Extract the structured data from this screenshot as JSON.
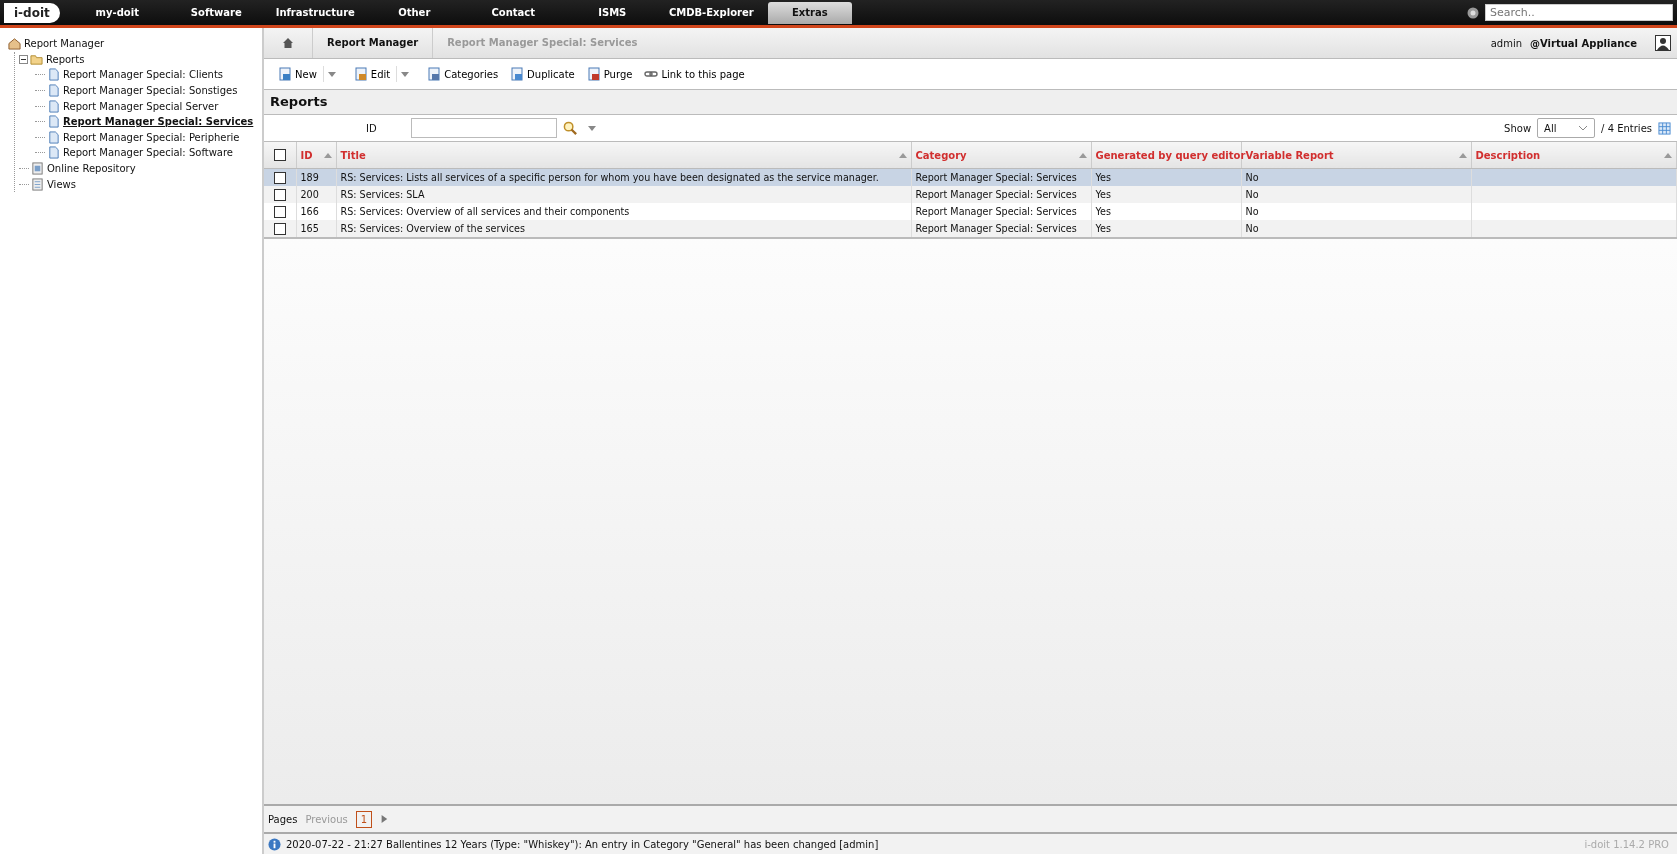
{
  "logo": "i-doit",
  "nav": [
    {
      "label": "my-doit",
      "selected": false
    },
    {
      "label": "Software",
      "selected": false
    },
    {
      "label": "Infrastructure",
      "selected": false
    },
    {
      "label": "Other",
      "selected": false
    },
    {
      "label": "Contact",
      "selected": false
    },
    {
      "label": "ISMS",
      "selected": false
    },
    {
      "label": "CMDB-Explorer",
      "selected": false
    },
    {
      "label": "Extras",
      "selected": true
    }
  ],
  "search": {
    "placeholder": "Search.."
  },
  "tree": [
    {
      "label": "Report Manager",
      "kind": "home",
      "children": [
        {
          "label": "Reports",
          "kind": "folder",
          "expanded": true,
          "children": [
            {
              "label": "Report Manager Special: Clients",
              "kind": "report",
              "selected": false
            },
            {
              "label": "Report Manager Special: Sonstiges",
              "kind": "report",
              "selected": false
            },
            {
              "label": "Report Manager Special Server",
              "kind": "report",
              "selected": false
            },
            {
              "label": "Report Manager Special: Services",
              "kind": "report",
              "selected": true
            },
            {
              "label": "Report Manager Special: Peripherie",
              "kind": "report",
              "selected": false
            },
            {
              "label": "Report Manager Special: Software",
              "kind": "report",
              "selected": false
            }
          ]
        },
        {
          "label": "Online Repository",
          "kind": "repo"
        },
        {
          "label": "Views",
          "kind": "views"
        }
      ]
    }
  ],
  "breadcrumb": [
    "Report Manager",
    "Report Manager Special: Services"
  ],
  "user": {
    "name": "admin",
    "tenant": "@Virtual Appliance"
  },
  "toolbar": [
    {
      "label": "New",
      "kind": "new",
      "menu": true
    },
    {
      "label": "Edit",
      "kind": "edit",
      "menu": true
    },
    {
      "label": "Categories",
      "kind": "categories",
      "menu": false
    },
    {
      "label": "Duplicate",
      "kind": "duplicate",
      "menu": false
    },
    {
      "label": "Purge",
      "kind": "purge",
      "menu": false
    },
    {
      "label": "Link to this page",
      "kind": "link",
      "menu": false
    }
  ],
  "heading": "Reports",
  "filter": {
    "label": "ID"
  },
  "show": {
    "label": "Show",
    "value": "All",
    "entries": "/ 4 Entries"
  },
  "table": {
    "select_all": {
      "checked": false
    },
    "columns": [
      "ID",
      "Title",
      "Category",
      "Generated by query editor",
      "Variable Report",
      "Description"
    ],
    "rows": [
      {
        "selected": true,
        "checked": false,
        "cells": [
          "189",
          "RS: Services: Lists all services of a specific person for whom you have been designated as the service manager.",
          "Report Manager Special: Services",
          "Yes",
          "No"
        ]
      },
      {
        "selected": false,
        "checked": false,
        "cells": [
          "200",
          "RS: Services: SLA",
          "Report Manager Special: Services",
          "Yes",
          "No"
        ]
      },
      {
        "selected": false,
        "checked": false,
        "cells": [
          "166",
          "RS: Services: Overview of all services and their components",
          "Report Manager Special: Services",
          "Yes",
          "No"
        ]
      },
      {
        "selected": false,
        "checked": false,
        "cells": [
          "165",
          "RS: Services: Overview of the services",
          "Report Manager Special: Services",
          "Yes",
          "No"
        ]
      }
    ]
  },
  "pager": {
    "label": "Pages",
    "previous": "Previous",
    "pages": [
      {
        "label": "1",
        "selected": true
      }
    ]
  },
  "status": {
    "message": "2020-07-22 - 21:27 Ballentines 12 Years (Type: \"Whiskey\"): An entry in Category \"General\" has been changed [admin]",
    "version": "i-doit 1.14.2 PRO"
  }
}
